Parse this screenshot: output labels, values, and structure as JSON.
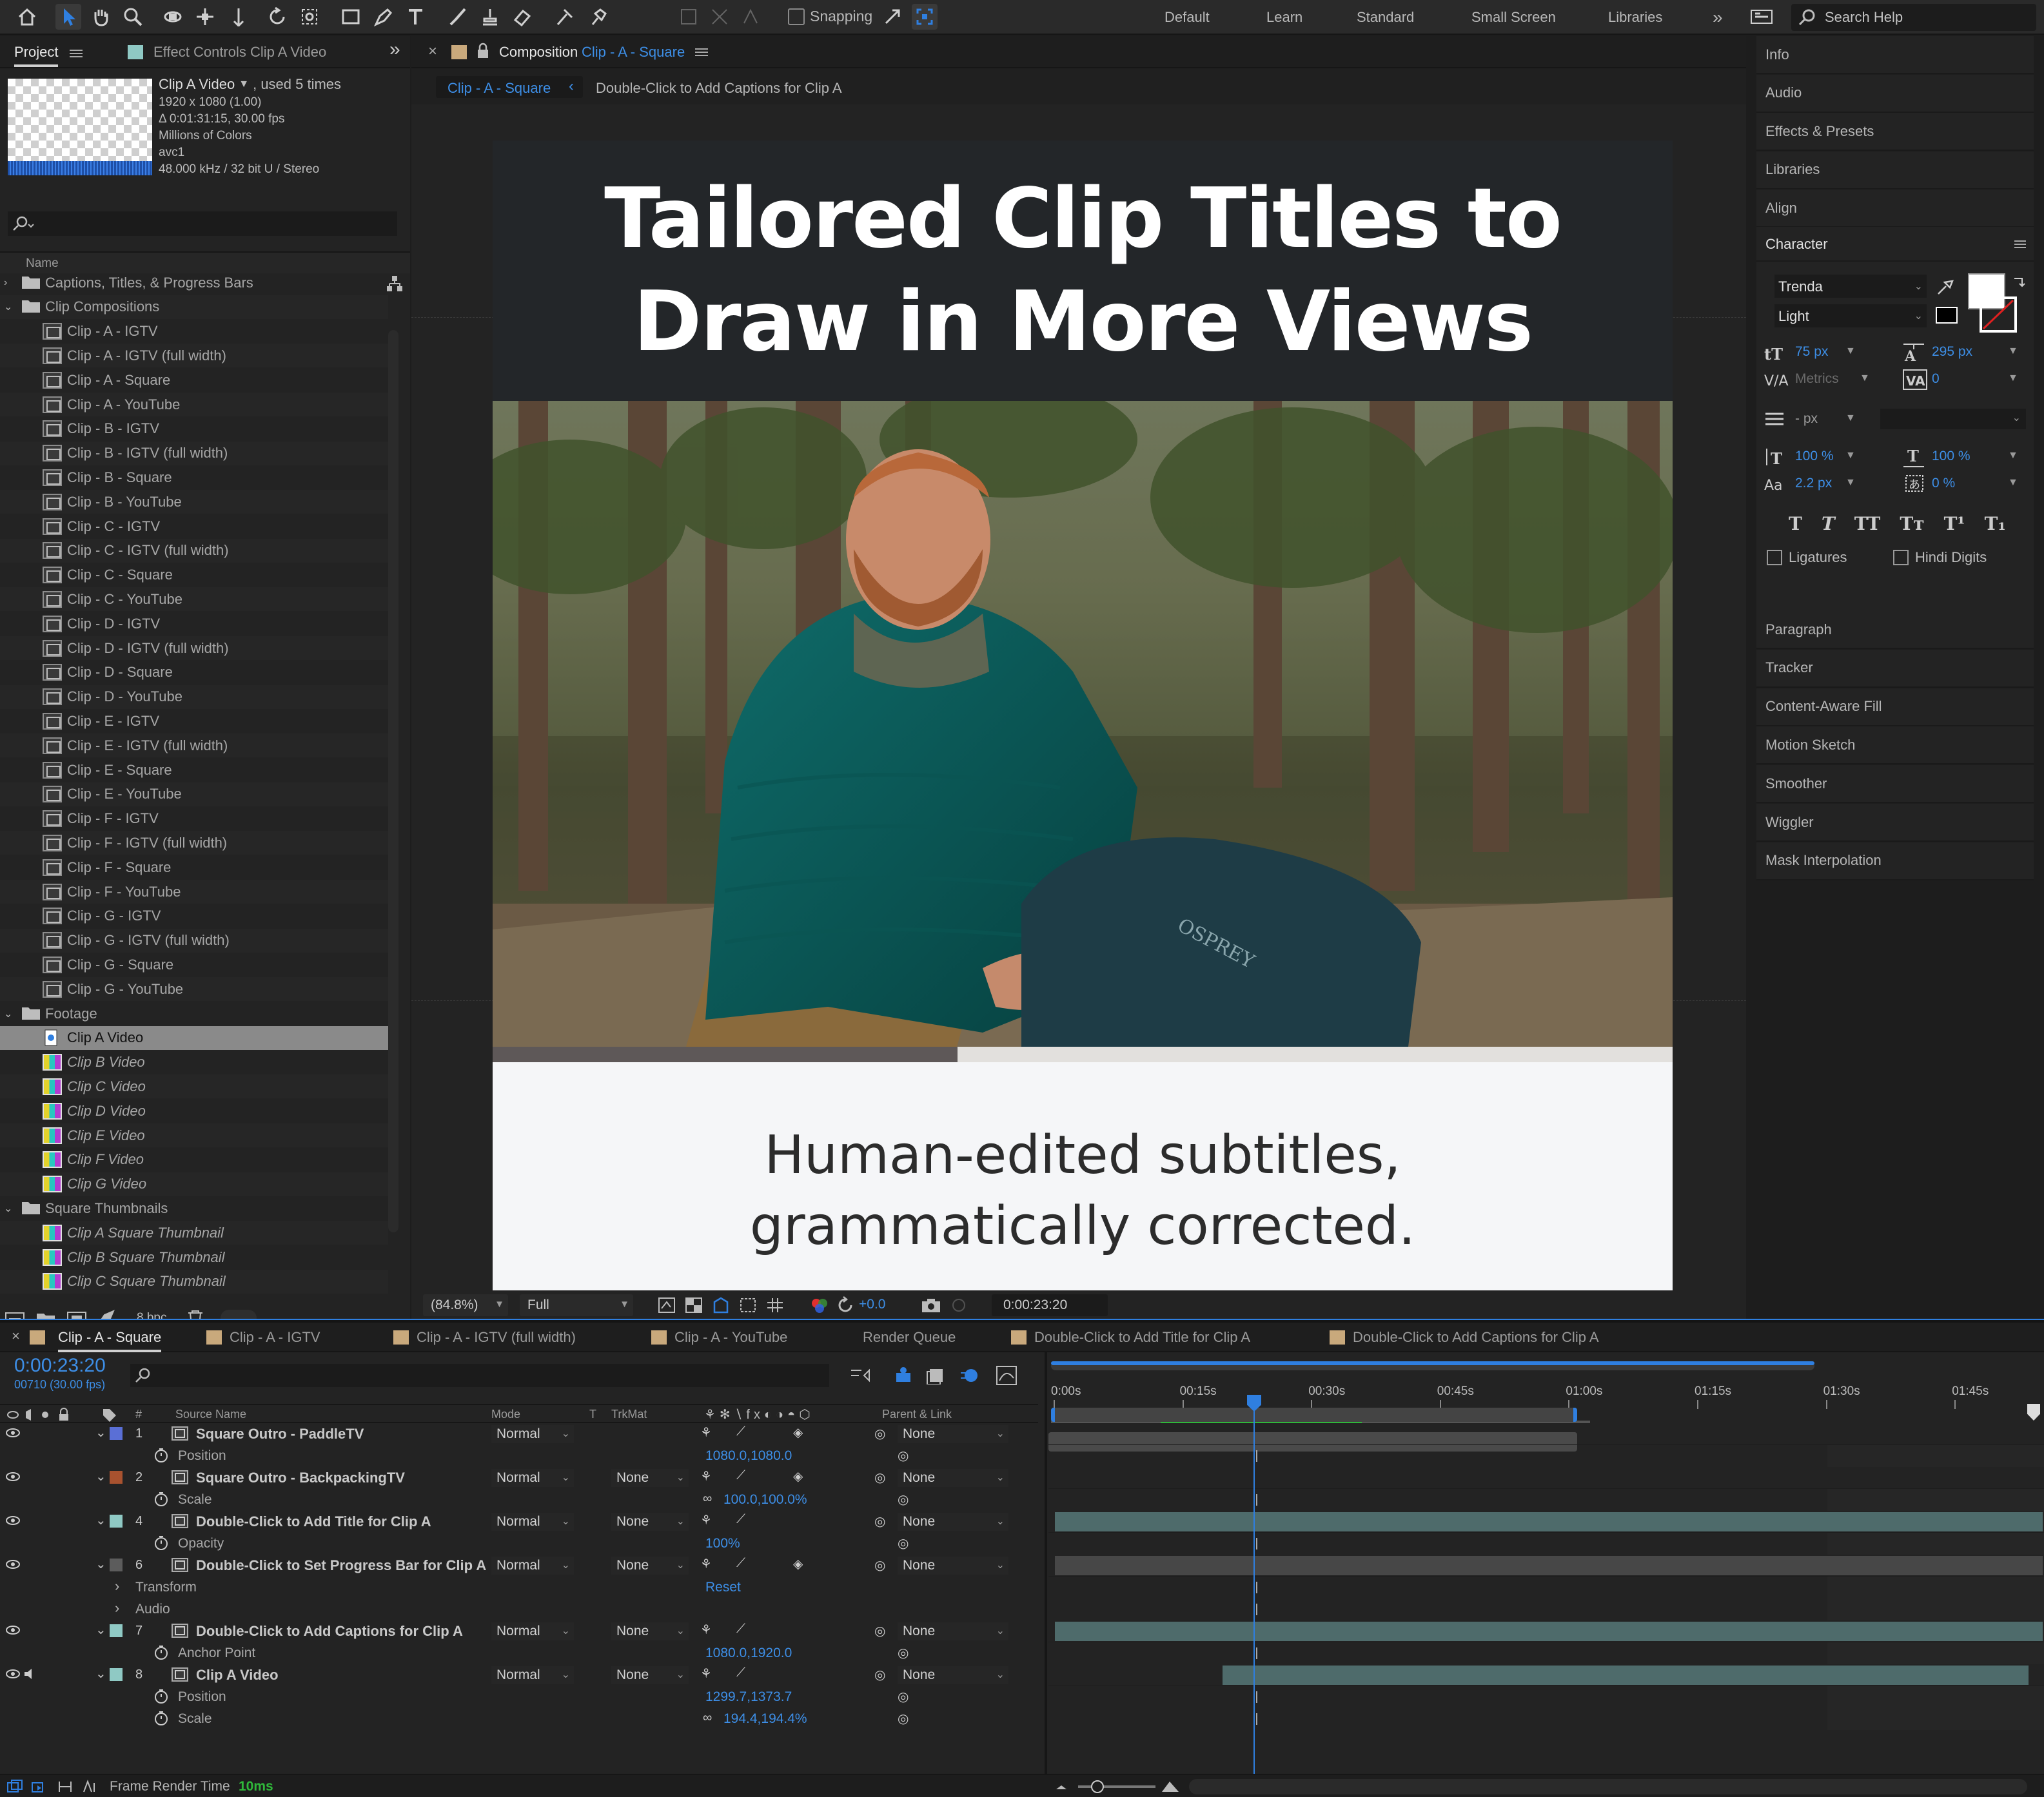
{
  "toolbar": {
    "snapping_label": "Snapping",
    "workspaces": [
      "Default",
      "Learn",
      "Standard",
      "Small Screen",
      "Libraries"
    ],
    "more": "»",
    "search_help": "Search Help"
  },
  "project_panel": {
    "tab_project": "Project",
    "tab_effects": "Effect Controls Clip A Video",
    "clip_name": "Clip A Video",
    "used_times": ", used 5 times",
    "info_lines": [
      "1920 x 1080 (1.00)",
      "Δ 0:01:31:15, 30.00 fps",
      "Millions of Colors",
      "avc1",
      "48.000 kHz / 32 bit U / Stereo"
    ],
    "search_placeholder": "",
    "col_name": "Name",
    "bpc": "8 bpc",
    "items": [
      {
        "type": "folder",
        "label": "Captions, Titles, & Progress Bars",
        "indent": 0,
        "open": false
      },
      {
        "type": "folder",
        "label": "Clip Compositions",
        "indent": 0,
        "open": true
      },
      {
        "type": "comp",
        "label": "Clip - A - IGTV",
        "indent": 1
      },
      {
        "type": "comp",
        "label": "Clip - A - IGTV (full width)",
        "indent": 1
      },
      {
        "type": "comp",
        "label": "Clip - A - Square",
        "indent": 1
      },
      {
        "type": "comp",
        "label": "Clip - A - YouTube",
        "indent": 1
      },
      {
        "type": "comp",
        "label": "Clip - B - IGTV",
        "indent": 1
      },
      {
        "type": "comp",
        "label": "Clip - B - IGTV (full width)",
        "indent": 1
      },
      {
        "type": "comp",
        "label": "Clip - B - Square",
        "indent": 1
      },
      {
        "type": "comp",
        "label": "Clip - B - YouTube",
        "indent": 1
      },
      {
        "type": "comp",
        "label": "Clip - C - IGTV",
        "indent": 1
      },
      {
        "type": "comp",
        "label": "Clip - C - IGTV (full width)",
        "indent": 1
      },
      {
        "type": "comp",
        "label": "Clip - C - Square",
        "indent": 1
      },
      {
        "type": "comp",
        "label": "Clip - C - YouTube",
        "indent": 1
      },
      {
        "type": "comp",
        "label": "Clip - D - IGTV",
        "indent": 1
      },
      {
        "type": "comp",
        "label": "Clip - D - IGTV (full width)",
        "indent": 1
      },
      {
        "type": "comp",
        "label": "Clip - D - Square",
        "indent": 1
      },
      {
        "type": "comp",
        "label": "Clip - D - YouTube",
        "indent": 1
      },
      {
        "type": "comp",
        "label": "Clip - E - IGTV",
        "indent": 1
      },
      {
        "type": "comp",
        "label": "Clip - E - IGTV (full width)",
        "indent": 1
      },
      {
        "type": "comp",
        "label": "Clip - E - Square",
        "indent": 1
      },
      {
        "type": "comp",
        "label": "Clip - E - YouTube",
        "indent": 1
      },
      {
        "type": "comp",
        "label": "Clip - F - IGTV",
        "indent": 1
      },
      {
        "type": "comp",
        "label": "Clip - F - IGTV (full width)",
        "indent": 1
      },
      {
        "type": "comp",
        "label": "Clip - F - Square",
        "indent": 1
      },
      {
        "type": "comp",
        "label": "Clip - F - YouTube",
        "indent": 1
      },
      {
        "type": "comp",
        "label": "Clip - G - IGTV",
        "indent": 1
      },
      {
        "type": "comp",
        "label": "Clip - G - IGTV (full width)",
        "indent": 1
      },
      {
        "type": "comp",
        "label": "Clip - G - Square",
        "indent": 1
      },
      {
        "type": "comp",
        "label": "Clip - G - YouTube",
        "indent": 1
      },
      {
        "type": "folder",
        "label": "Footage",
        "indent": 0,
        "open": true
      },
      {
        "type": "footage-sel",
        "label": "Clip A Video",
        "indent": 1
      },
      {
        "type": "video",
        "label": "Clip B Video",
        "indent": 1
      },
      {
        "type": "video",
        "label": "Clip C Video",
        "indent": 1
      },
      {
        "type": "video",
        "label": "Clip D Video",
        "indent": 1
      },
      {
        "type": "video",
        "label": "Clip E Video",
        "indent": 1
      },
      {
        "type": "video",
        "label": "Clip F Video",
        "indent": 1
      },
      {
        "type": "video",
        "label": "Clip G Video",
        "indent": 1
      },
      {
        "type": "folder",
        "label": "Square Thumbnails",
        "indent": 0,
        "open": true
      },
      {
        "type": "video",
        "label": "Clip A Square Thumbnail",
        "indent": 1
      },
      {
        "type": "video",
        "label": "Clip B Square Thumbnail",
        "indent": 1
      },
      {
        "type": "video",
        "label": "Clip C Square Thumbnail",
        "indent": 1
      }
    ]
  },
  "composition": {
    "tab_prefix": "Composition",
    "tab_name": "Clip - A - Square",
    "crumb_current": "Clip - A - Square",
    "crumb_next": "Double-Click to Add Captions for Clip A",
    "title_line1": "Tailored Clip Titles to",
    "title_line2": "Draw in More Views",
    "caption_line1": "Human-edited subtitles,",
    "caption_line2": "grammatically corrected.",
    "progress": 0.394,
    "zoom": "(84.8%)",
    "resolution": "Full",
    "exposure": "+0.0",
    "timecode": "0:00:23:20"
  },
  "right_panel": {
    "items_top": [
      "Info",
      "Audio",
      "Effects & Presets",
      "Libraries",
      "Align"
    ],
    "character_title": "Character",
    "font_family": "Trenda",
    "font_style": "Light",
    "font_size": "75 px",
    "leading": "295 px",
    "kerning": "Metrics",
    "tracking": "0",
    "stroke_width": "- px",
    "vert_scale": "100 %",
    "horiz_scale": "100 %",
    "baseline_shift": "2.2 px",
    "tsume": "0 %",
    "ligatures": "Ligatures",
    "hindi_digits": "Hindi Digits",
    "items_bottom": [
      "Paragraph",
      "Tracker",
      "Content-Aware Fill",
      "Motion Sketch",
      "Smoother",
      "Wiggler",
      "Mask Interpolation"
    ]
  },
  "timeline": {
    "tabs": [
      "Clip - A - Square",
      "Clip - A - IGTV",
      "Clip - A - IGTV (full width)",
      "Clip - A - YouTube",
      "Render Queue",
      "Double-Click to Add Title for Clip A",
      "Double-Click to Add Captions for Clip A"
    ],
    "timecode": "0:00:23:20",
    "frame_info": "00710 (30.00 fps)",
    "col_source": "Source Name",
    "col_mode": "Mode",
    "col_t": "T",
    "col_trkmat": "TrkMat",
    "col_parent": "Parent & Link",
    "col_num": "#",
    "ruler": [
      "0:00s",
      "00:15s",
      "00:30s",
      "00:45s",
      "01:00s",
      "01:15s",
      "01:30s",
      "01:45s"
    ],
    "layers": [
      {
        "num": "1",
        "name": "Square Outro - PaddleTV",
        "color": "#5a6fd6",
        "mode": "Normal",
        "trkmat": "",
        "parent": "None"
      },
      {
        "num": "2",
        "name": "Square Outro - BackpackingTV",
        "color": "#a8522f",
        "mode": "Normal",
        "trkmat": "None",
        "parent": "None"
      },
      {
        "num": "4",
        "name": "Double-Click to Add Title for Clip A",
        "color": "#8fc9c4",
        "mode": "Normal",
        "trkmat": "None",
        "parent": "None"
      },
      {
        "num": "6",
        "name": "Double-Click to Set Progress Bar for Clip A",
        "color": "#5c5c5c",
        "mode": "Normal",
        "trkmat": "None",
        "parent": "None"
      },
      {
        "num": "7",
        "name": "Double-Click to Add Captions for Clip A",
        "color": "#8fc9c4",
        "mode": "Normal",
        "trkmat": "None",
        "parent": "None"
      },
      {
        "num": "8",
        "name": "Clip A Video",
        "color": "#8fc9c4",
        "mode": "Normal",
        "trkmat": "None",
        "parent": "None"
      }
    ],
    "props": {
      "position": "Position",
      "position_val": "1080.0,1080.0",
      "scale": "Scale",
      "scale_val": "100.0,100.0%",
      "opacity": "Opacity",
      "opacity_val": "100%",
      "transform": "Transform",
      "reset": "Reset",
      "audio": "Audio",
      "anchor": "Anchor Point",
      "anchor_val": "1080.0,1920.0",
      "position8_val": "1299.7,1373.7",
      "scale8_val": "194.4,194.4%"
    },
    "footer_label": "Frame Render Time",
    "footer_value": "10ms"
  },
  "colors": {
    "accent": "#3d8ee6",
    "panel": "#232323",
    "bg": "#1d1d1d",
    "bar_teal": "#4e6b6b"
  }
}
